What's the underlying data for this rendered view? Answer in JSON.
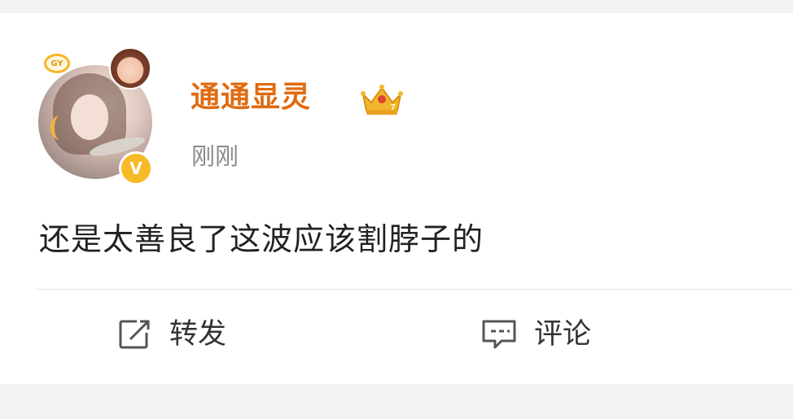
{
  "post": {
    "username": "通通显灵",
    "time": "刚刚",
    "content": "还是太善良了这波应该割脖子的",
    "avatar_deco_text": "GY",
    "verify_mark": "V",
    "crown_level": "7"
  },
  "actions": {
    "repost_label": "转发",
    "comment_label": "评论"
  },
  "icons": {
    "repost": "share-edit-icon",
    "comment": "comment-bubble-icon",
    "crown": "crown-icon",
    "verify": "verified-badge-icon"
  },
  "colors": {
    "username": "#e06b10",
    "verify": "#f6ba26",
    "time": "#8a8a8a",
    "text": "#222222",
    "background": "#f2f2f2"
  }
}
